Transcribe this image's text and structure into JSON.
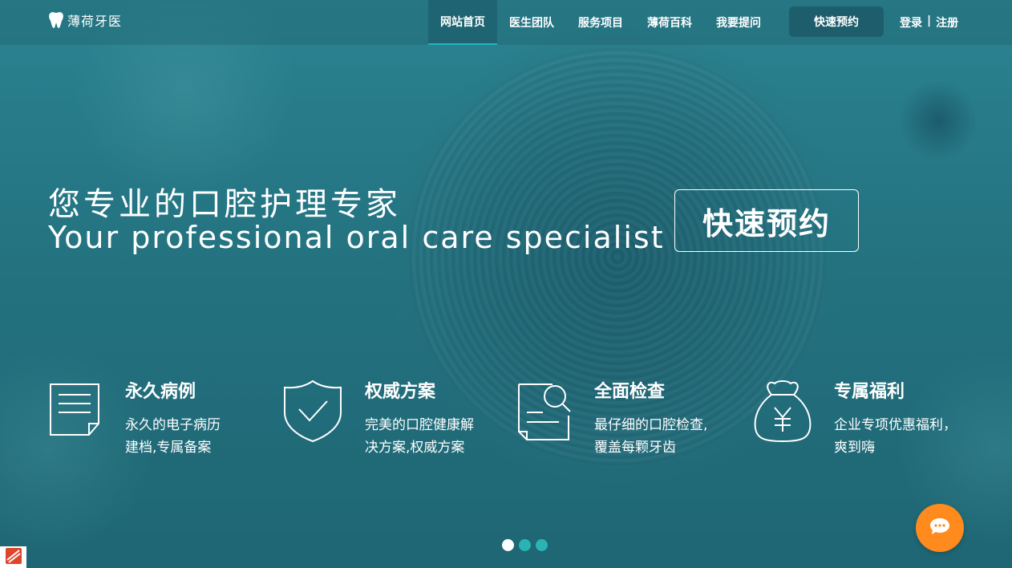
{
  "header": {
    "logo_text": "薄荷牙医",
    "nav": [
      {
        "label": "网站首页",
        "active": true
      },
      {
        "label": "医生团队",
        "active": false
      },
      {
        "label": "服务项目",
        "active": false
      },
      {
        "label": "薄荷百科",
        "active": false
      },
      {
        "label": "我要提问",
        "active": false
      }
    ],
    "quick_button": "快速预约",
    "login": "登录",
    "separator": "|",
    "register": "注册"
  },
  "hero": {
    "title_cn": "您专业的口腔护理专家",
    "title_en": "Your professional oral care specialist",
    "cta": "快速预约"
  },
  "features": [
    {
      "icon": "document-icon",
      "title": "永久病例",
      "desc_line1": "永久的电子病历",
      "desc_line2": "建档,专属备案"
    },
    {
      "icon": "shield-check-icon",
      "title": "权威方案",
      "desc_line1": "完美的口腔健康解",
      "desc_line2": "决方案,权威方案"
    },
    {
      "icon": "document-search-icon",
      "title": "全面检查",
      "desc_line1": "最仔细的口腔检查,",
      "desc_line2": "覆盖每颗牙齿"
    },
    {
      "icon": "money-bag-icon",
      "title": "专属福利",
      "desc_line1": "企业专项优惠福利，",
      "desc_line2": "爽到嗨"
    }
  ],
  "slider": {
    "count": 3,
    "active_index": 0
  },
  "colors": {
    "nav_active_underline": "#23b6b9",
    "quick_button_bg": "#1d5d6c",
    "chat_button_bg": "#ff8a1e",
    "dot_inactive": "#2ab3b5",
    "dot_active": "#ffffff"
  }
}
